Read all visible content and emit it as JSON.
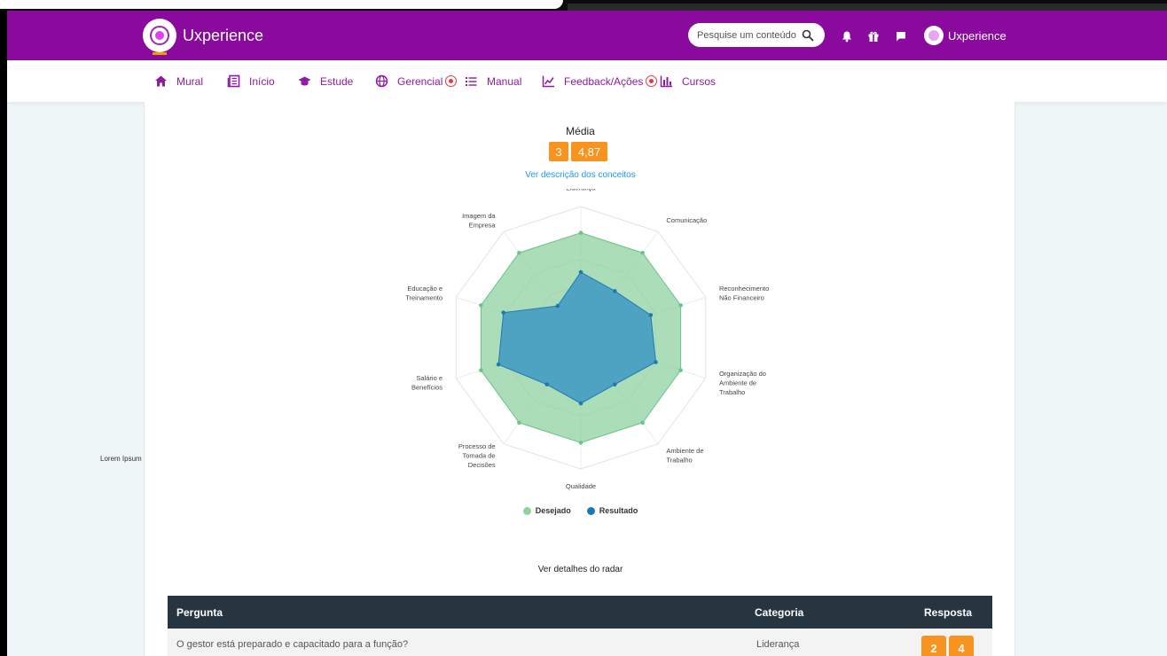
{
  "app": {
    "brand": "Uxperience"
  },
  "search": {
    "placeholder": "Pesquise um conteúdo"
  },
  "user": {
    "name": "Uxperience"
  },
  "nav": [
    {
      "label": "Mural",
      "icon": "home-icon"
    },
    {
      "label": "Início",
      "icon": "newspaper-icon"
    },
    {
      "label": "Estude",
      "icon": "graduation-cap-icon"
    },
    {
      "label": "Gerencial",
      "icon": "globe-icon",
      "badge": true
    },
    {
      "label": "Manual",
      "icon": "list-icon"
    },
    {
      "label": "Feedback/Ações",
      "icon": "line-chart-icon",
      "badge": true
    },
    {
      "label": "Cursos",
      "icon": "bar-chart-icon"
    }
  ],
  "side_label": "Lorem Ipsum",
  "media": {
    "title": "Média",
    "value_a": "3",
    "value_b": "4,87"
  },
  "desc_link": "Ver descrição dos conceitos",
  "chart_data": {
    "type": "radar",
    "title": "",
    "categories": [
      [
        "Liderança"
      ],
      [
        "Comunicação"
      ],
      [
        "Reconhecimento",
        "Não Financeiro"
      ],
      [
        "Organização do",
        "Ambiente de",
        "Trabalho"
      ],
      [
        "Ambiente de",
        "Trabalho"
      ],
      [
        "Qualidade"
      ],
      [
        "Processo de",
        "Tomada de",
        "Decisões"
      ],
      [
        "Salário e",
        "Benefícios"
      ],
      [
        "Educação e",
        "Treinamento"
      ],
      [
        "Imagem da",
        "Empresa"
      ]
    ],
    "rlim": [
      0,
      5
    ],
    "grid_levels": 5,
    "series": [
      {
        "name": "Desejado",
        "color": "#8fd3a0",
        "stroke": "#6cc488",
        "values": [
          4,
          4,
          4,
          4,
          4,
          4,
          4,
          4,
          4,
          4
        ]
      },
      {
        "name": "Resultado",
        "color": "#2f8fc6",
        "stroke": "#1f77b4",
        "values": [
          2.5,
          2.2,
          2.8,
          3.0,
          2.2,
          2.5,
          2.2,
          3.3,
          3.1,
          1.5
        ]
      }
    ],
    "legend": "bottom"
  },
  "radar_details": "Ver detalhes do radar",
  "table": {
    "headers": {
      "question": "Pergunta",
      "category": "Categoria",
      "answer": "Resposta"
    },
    "rows": [
      {
        "question": "O gestor está preparado e capacitado para a função?",
        "category": "Liderança",
        "answer_a": "2",
        "answer_b": "4"
      }
    ]
  },
  "colors": {
    "brand": "#8a0a9e",
    "accent": "#f7931e",
    "table_header": "#263540",
    "link": "#2196f3"
  }
}
